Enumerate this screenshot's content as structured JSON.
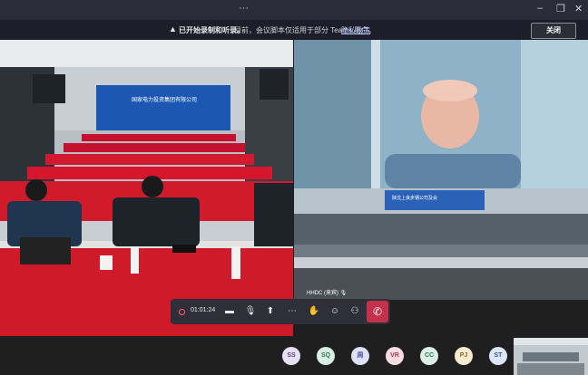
{
  "banner": {
    "recording_label": "已开始录制和听录。",
    "message": "目前，会议脚本仅适用于部分 Teams 用户。",
    "privacy_link": "隐私政策",
    "close_label": "关闭"
  },
  "room_sign": "国家电力投资集团有限公司",
  "room2_sign": "陕沈上良步钢公司及会",
  "participant_tile_name": "HHDC (来宾)",
  "controls": {
    "timer": "01:01:24"
  },
  "participants": [
    {
      "initials": "SS",
      "bg": "#e9e0f5",
      "fg": "#5b4b8a"
    },
    {
      "initials": "SQ",
      "bg": "#d8efe6",
      "fg": "#2f7a5b"
    },
    {
      "initials": "周",
      "bg": "#dde0f7",
      "fg": "#4a4f9a"
    },
    {
      "initials": "VR",
      "bg": "#f5dde3",
      "fg": "#a23b55"
    },
    {
      "initials": "CC",
      "bg": "#dcf0e6",
      "fg": "#2f7a5b"
    },
    {
      "initials": "PJ",
      "bg": "#f8ecd2",
      "fg": "#8a6a1d"
    },
    {
      "initials": "ST",
      "bg": "#dbe6f7",
      "fg": "#3b5e9a"
    }
  ]
}
